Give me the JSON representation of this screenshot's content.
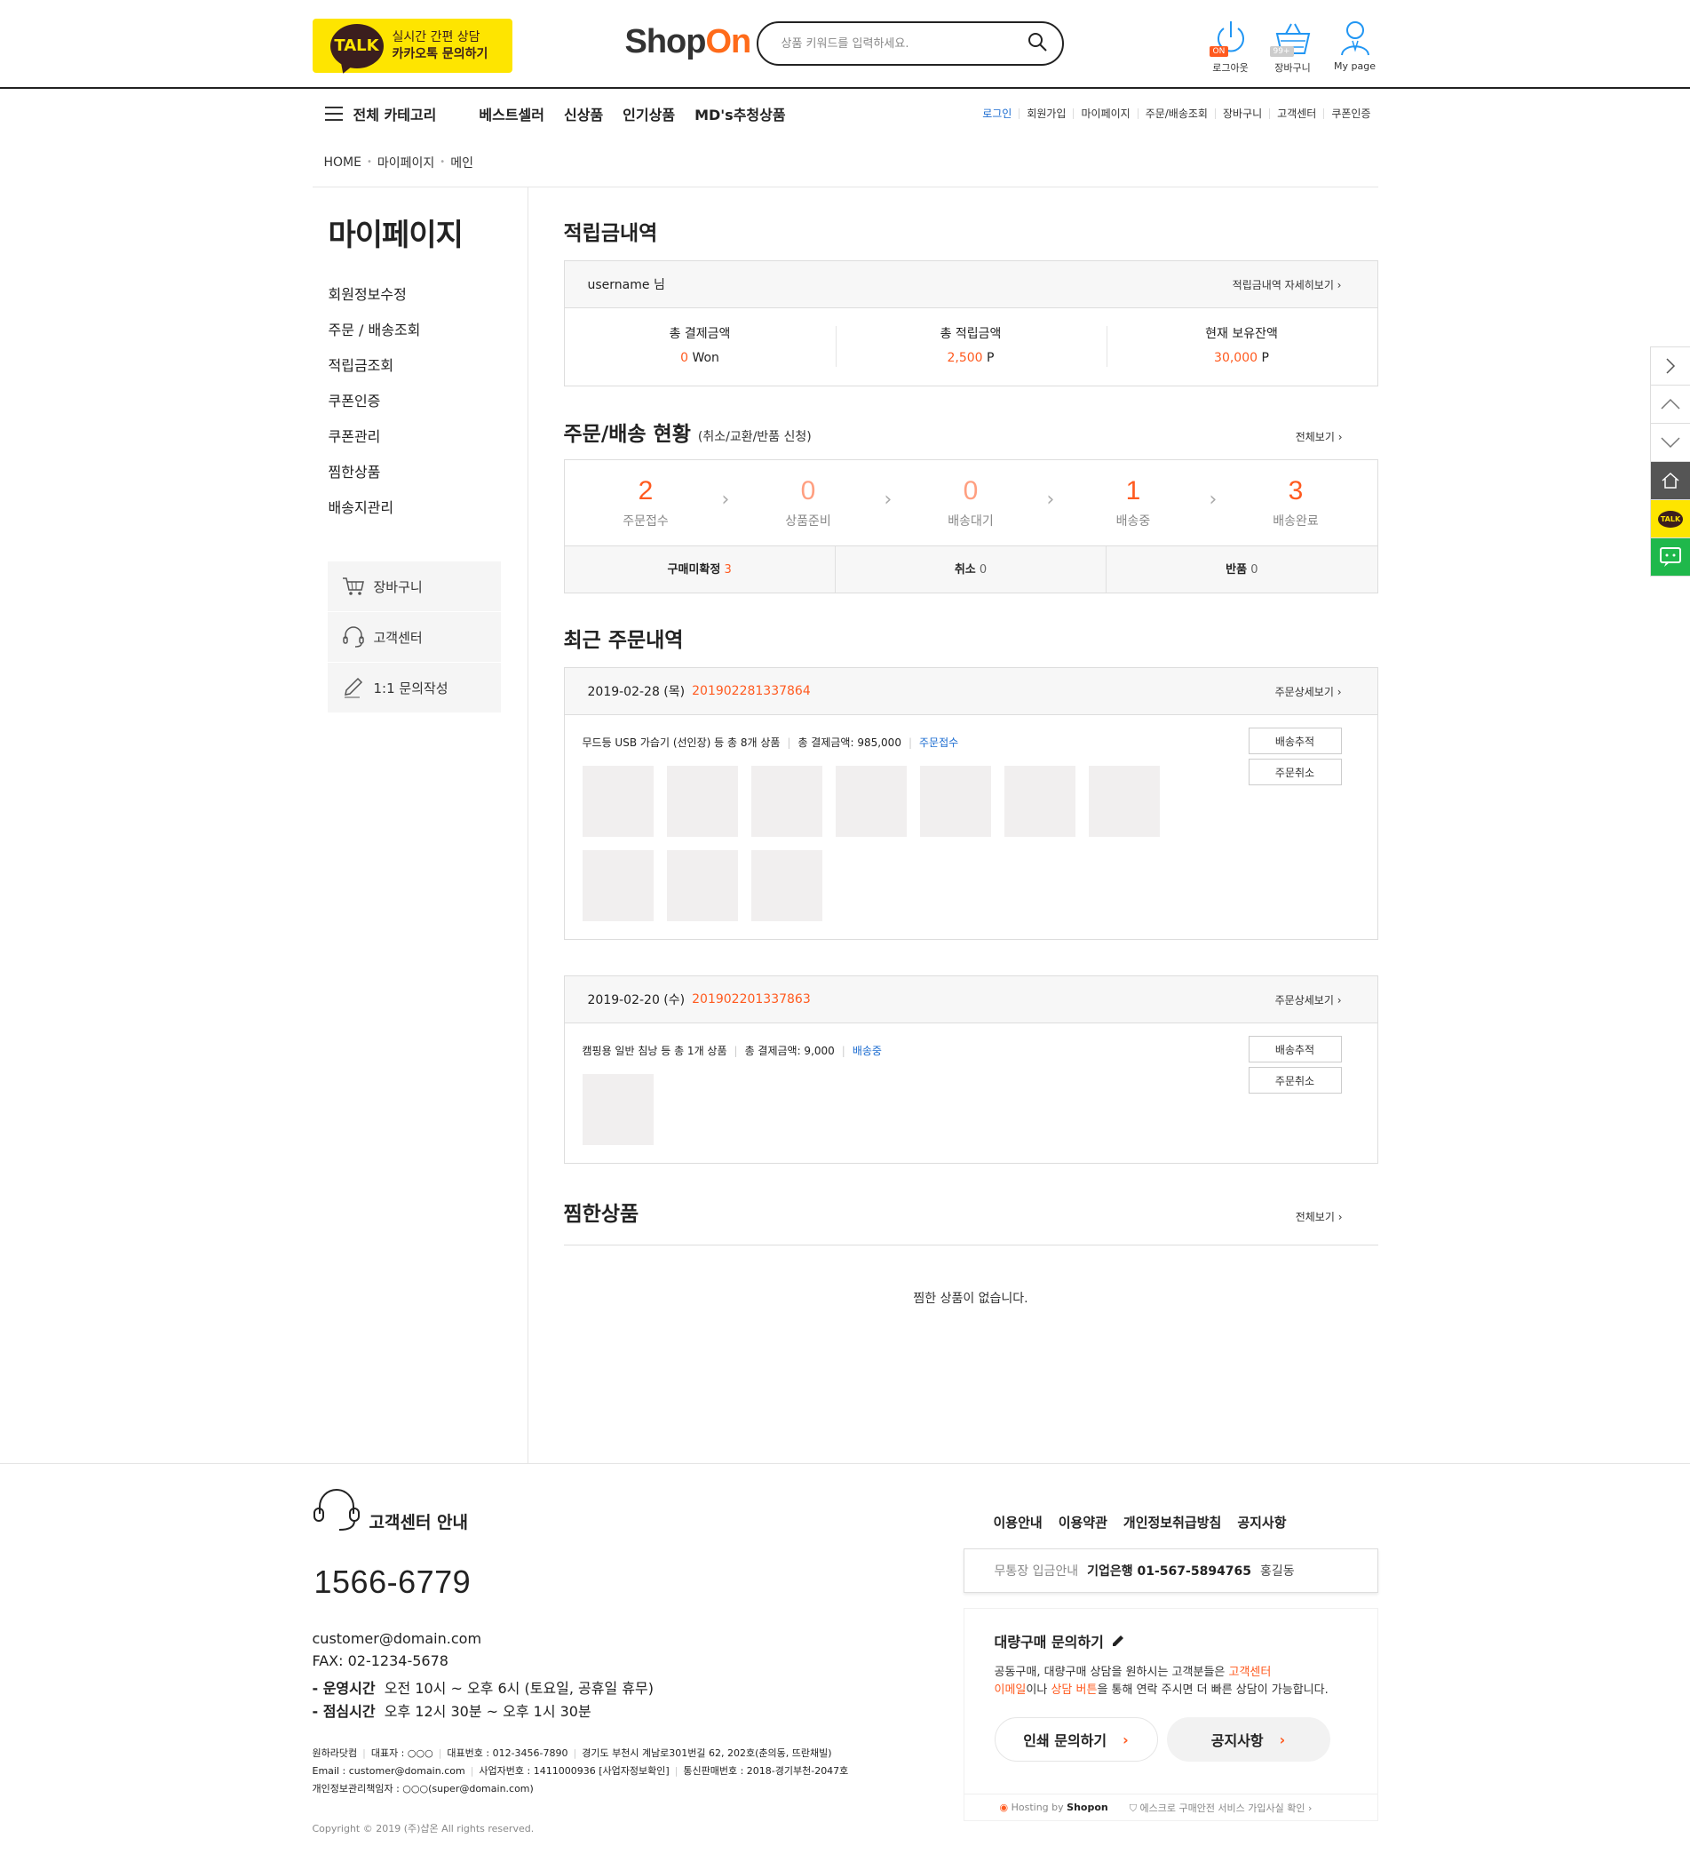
{
  "header": {
    "talk_badge": "TALK",
    "talk_line1": "실시간 간편 상담",
    "talk_line2": "카카오톡 문의하기",
    "logo_shop": "Shop",
    "logo_on": "On",
    "search_placeholder": "상품 키워드를 입력하세요.",
    "logout_label": "로그아웃",
    "logout_badge": "ON",
    "cart_label": "장바구니",
    "cart_badge": "99+",
    "mypage_label": "My page"
  },
  "nav": {
    "all_category": "전체 카테고리",
    "gnb": [
      "베스트셀러",
      "신상품",
      "인기상품",
      "MD's추청상품"
    ],
    "util": [
      "로그인",
      "회원가입",
      "마이페이지",
      "주문/배송조회",
      "장바구니",
      "고객센터",
      "쿠폰인증"
    ]
  },
  "breadcrumb": [
    "HOME",
    "마이페이지",
    "메인"
  ],
  "lnb": {
    "title": "마이페이지",
    "items": [
      "회원정보수정",
      "주문 / 배송조회",
      "적립금조회",
      "쿠폰인증",
      "쿠폰관리",
      "찜한상품",
      "배송지관리"
    ],
    "quick": [
      "장바구니",
      "고객센터",
      "1:1 문의작성"
    ]
  },
  "points": {
    "title": "적립금내역",
    "username": "username 님",
    "more": "적립금내역 자세히보기 ›",
    "cols": [
      {
        "label": "총 결제금액",
        "value": "0",
        "unit": " Won"
      },
      {
        "label": "총 적립금액",
        "value": "2,500",
        "unit": " P"
      },
      {
        "label": "현재 보유잔액",
        "value": "30,000",
        "unit": " P"
      }
    ]
  },
  "status": {
    "title": "주문/배송 현황",
    "sub": "(취소/교환/반품 신청)",
    "more": "전체보기 ›",
    "steps": [
      {
        "n": "2",
        "label": "주문접수"
      },
      {
        "n": "0",
        "label": "상품준비"
      },
      {
        "n": "0",
        "label": "배송대기"
      },
      {
        "n": "1",
        "label": "배송중"
      },
      {
        "n": "3",
        "label": "배송완료"
      }
    ],
    "bottom": [
      {
        "label": "구매미확정",
        "count": "3"
      },
      {
        "label": "취소",
        "count": "0"
      },
      {
        "label": "반품",
        "count": "0"
      }
    ]
  },
  "orders": {
    "title": "최근 주문내역",
    "detail_label": "주문상세보기 ›",
    "track_label": "배송추적",
    "cancel_label": "주문취소",
    "list": [
      {
        "date": "2019-02-28 (목)",
        "no": "201902281337864",
        "summary": "무드등 USB 가습기 (선인장) 등 총 8개 상품",
        "total": "총 결제금액: 985,000",
        "state": "주문접수",
        "thumbs": 10
      },
      {
        "date": "2019-02-20 (수)",
        "no": "201902201337863",
        "summary": "캠핑용 일반 침낭 등 총 1개 상품",
        "total": "총 결제금액: 9,000",
        "state": "배송중",
        "thumbs": 1
      }
    ]
  },
  "wish": {
    "title": "찜한상품",
    "more": "전체보기 ›",
    "empty": "찜한 상품이 없습니다."
  },
  "footer": {
    "cs_title": "고객센터 안내",
    "phone": "1566-6779",
    "email": "customer@domain.com",
    "fax": "FAX: 02-1234-5678",
    "hours_label": "- 운영시간",
    "hours": "오전 10시 ~ 오후 6시 (토요일, 공휴일 휴무)",
    "lunch_label": "- 점심시간",
    "lunch": "오후 12시 30분 ~ 오후 1시 30분",
    "company1": [
      "원하라닷컴",
      "대표자 : ○○○",
      "대표번호 : 012-3456-7890",
      "경기도 부천시 계남로301번길 62, 202호(춘의동, 뜨란채빌)"
    ],
    "company2": [
      "Email : customer@domain.com",
      "사업자번호 : 1411000936 [사업자정보확인]",
      "통신판매번호 : 2018-경기부천-2047호"
    ],
    "company3": "개인정보관리책임자 : ○○○(super@domain.com)",
    "copyright": "Copyright © 2019 (주)샵온 All rights reserved.",
    "links": [
      "이용안내",
      "이용약관",
      "개인정보취급방침",
      "공지사항"
    ],
    "bank_label": "무통장 입금안내",
    "bank": "기업은행 01-567-5894765",
    "bank_name": "홍길동",
    "bulk_title": "대량구매 문의하기",
    "bulk_p1a": "공동구매, 대량구매 상담을 원하시는 고객분들은 ",
    "bulk_p1b": "고객센터",
    "bulk_p2a": "이메일",
    "bulk_p2b": "이나 ",
    "bulk_p2c": "상담 버튼",
    "bulk_p2d": "을 통해 연락 주시면 더 빠른 상담이 가능합니다.",
    "btn_print": "인쇄 문의하기",
    "btn_notice": "공지사항",
    "hosting_a": "Hosting by ",
    "hosting_b": "Shopon",
    "escrow": "에스크로 구매안전 서비스 가입사실 확인 ›"
  },
  "quickbar": [
    "next-icon",
    "up-icon",
    "down-icon",
    "home-icon",
    "talk-icon",
    "chat-icon"
  ],
  "quick_talk": "TALK",
  "colors": {
    "accent": "#ff5a1f",
    "link": "#1a6bd0",
    "kakao": "#fee500"
  }
}
